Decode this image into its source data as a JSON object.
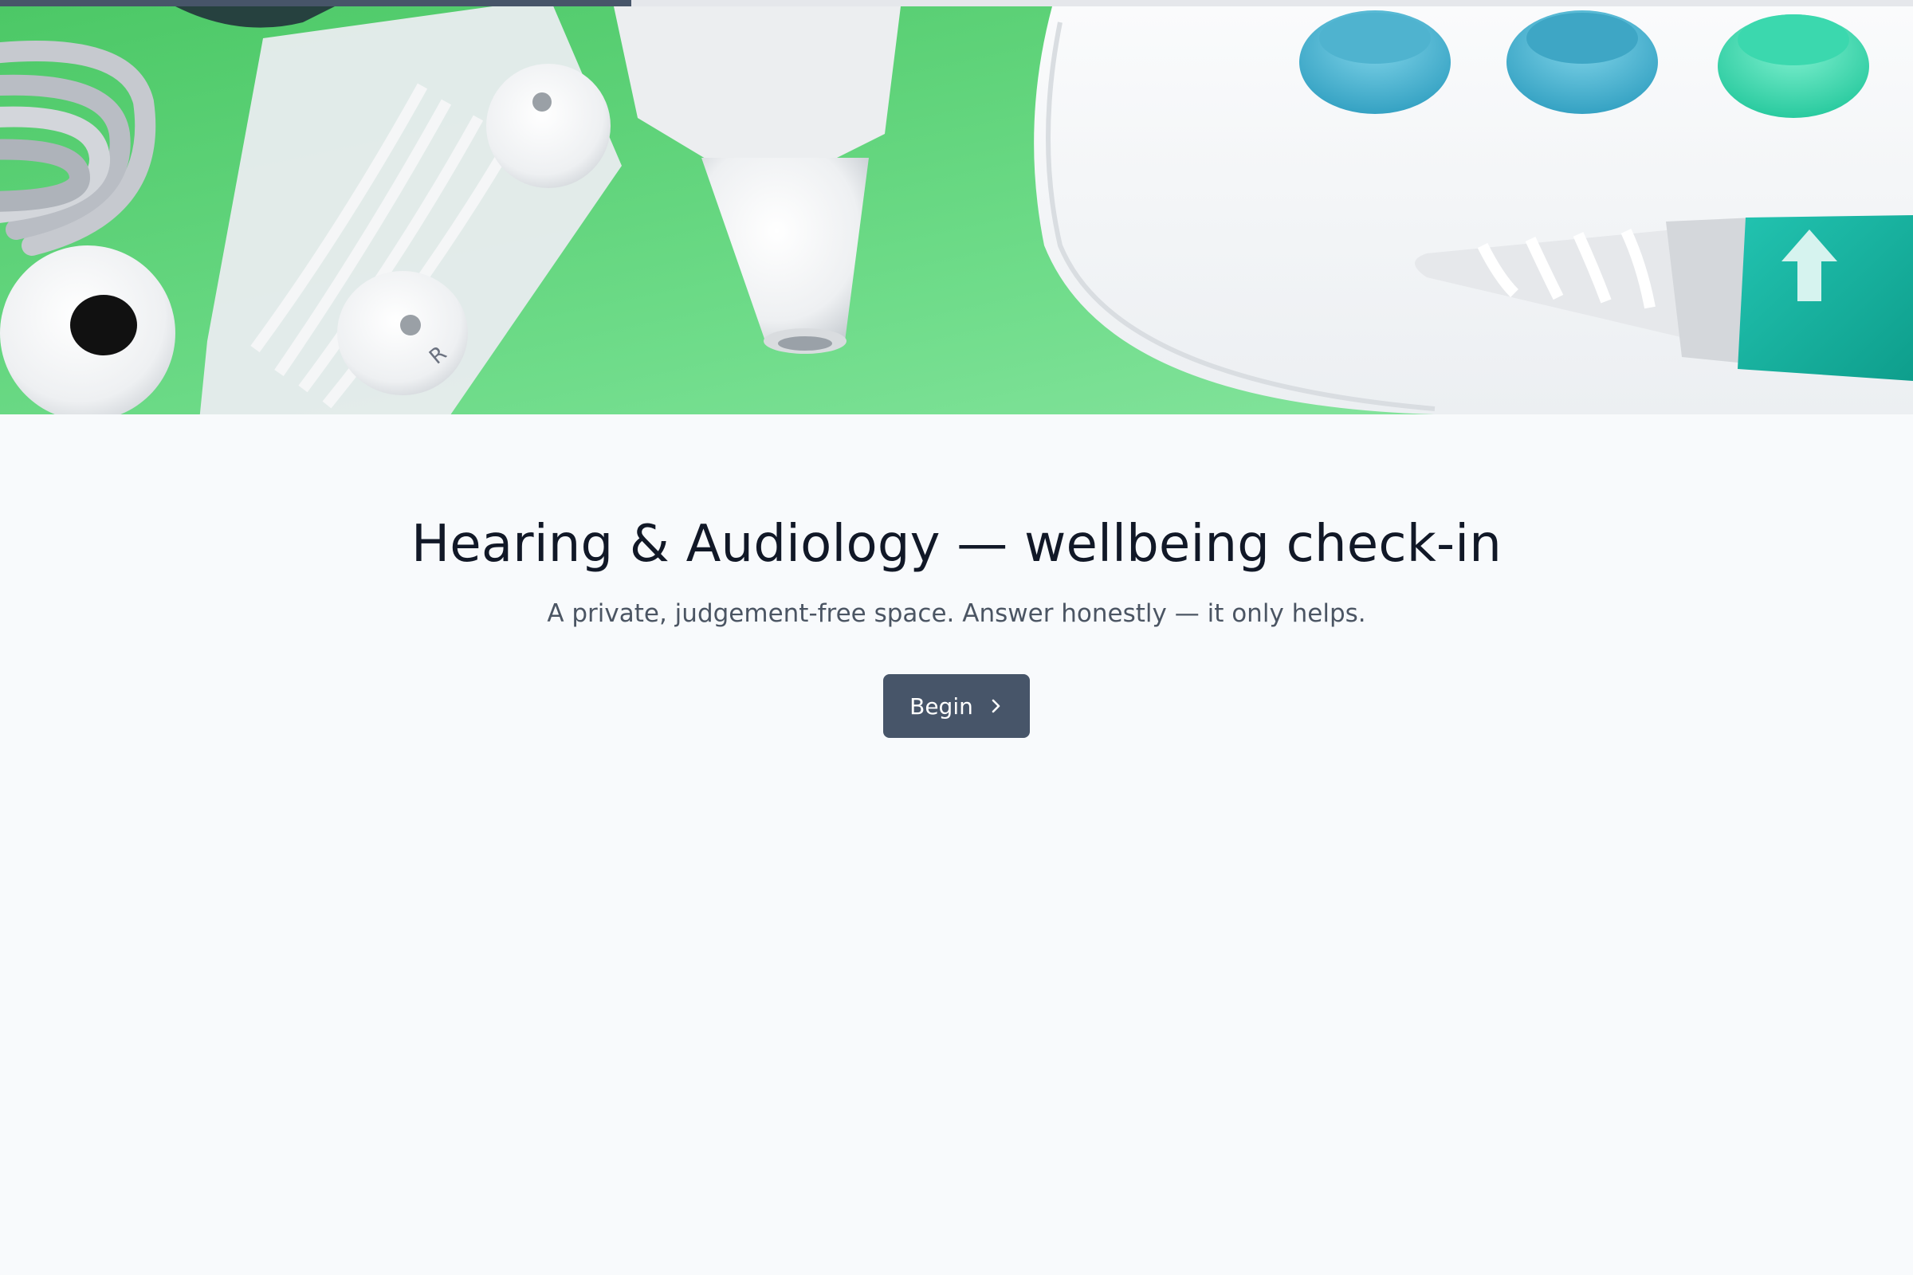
{
  "progress": {
    "fraction": 0.33
  },
  "hero": {
    "image": "hearing-accessories-photo",
    "icon_descriptions": [
      "earbud",
      "earphones",
      "otoscope-tip",
      "ear-cleaner",
      "ear-tips"
    ]
  },
  "intro": {
    "title": "Hearing & Audiology — wellbeing check-in",
    "subtitle": "A private, judgement-free space. Answer honestly — it only helps.",
    "begin_label": "Begin",
    "begin_icon": "chevron-right-icon"
  },
  "colors": {
    "accent": "#475569",
    "background": "#f8fafc",
    "title": "#111827",
    "subtitle": "#4b5563",
    "hero_green": "#5fd17a"
  }
}
